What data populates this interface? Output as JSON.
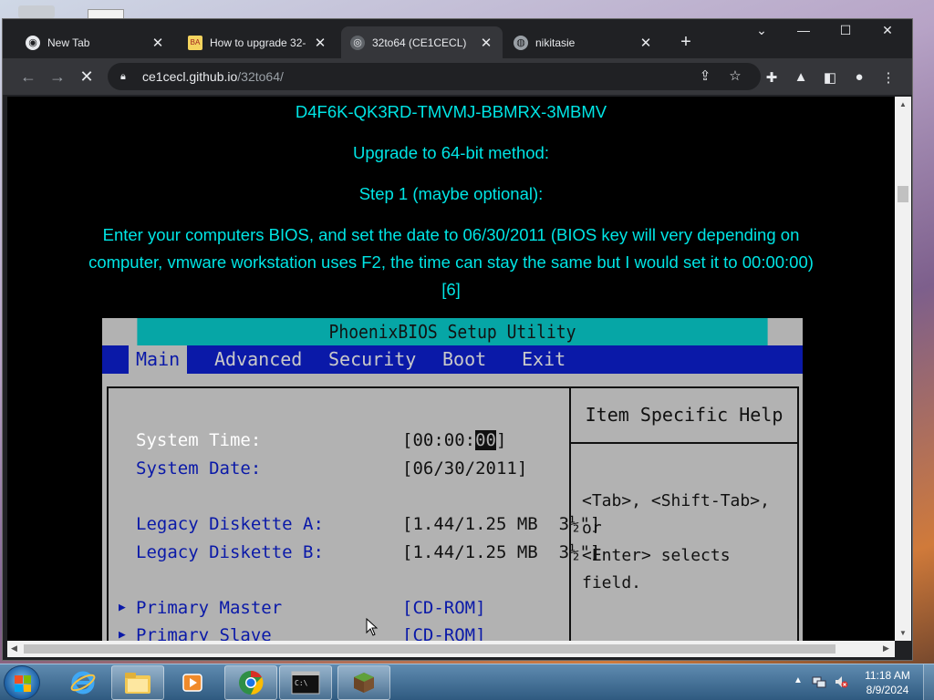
{
  "browser": {
    "tabs": [
      {
        "title": "New Tab",
        "icon": "chrome-icon"
      },
      {
        "title": "How to upgrade 32-",
        "icon": "site-favicon"
      },
      {
        "title": "32to64 (CE1CECL)",
        "icon": "github-favicon",
        "active": true
      },
      {
        "title": "nikitasie",
        "icon": "globe-icon"
      }
    ],
    "new_tab_symbol": "+",
    "window_controls": {
      "tab_search": "⌄",
      "minimize": "—",
      "maximize": "☐",
      "close": "✕"
    },
    "toolbar": {
      "back": "←",
      "forward": "→",
      "stop": "✕",
      "url_host": "ce1cecl.github.io",
      "url_path": "/32to64/"
    }
  },
  "page": {
    "line_key": "D4F6K-QK3RD-TMVMJ-BBMRX-3MBMV",
    "line_method": "Upgrade to 64-bit method:",
    "line_step": "Step 1 (maybe optional):",
    "para_1": "Enter your computers BIOS, and set the date to 06/30/2011 (BIOS key will very depending on",
    "para_2": "computer, vmware workstation uses F2, the time can stay the same but I would set it to 00:00:00)",
    "para_3": "[6]"
  },
  "bios": {
    "title": "PhoenixBIOS Setup Utility",
    "menu": [
      "Main",
      "Advanced",
      "Security",
      "Boot",
      "Exit"
    ],
    "help_title": "Item Specific Help",
    "help_line_1": "<Tab>, <Shift-Tab>, or",
    "help_line_2": "<Enter> selects field.",
    "fields": {
      "system_time_label": "System Time:",
      "system_time_prefix": "[00:00:",
      "system_time_cursor": "00",
      "system_time_suffix": "]",
      "system_date_label": "System Date:",
      "system_date_value": "[06/30/2011]",
      "diskette_a_label": "Legacy Diskette A:",
      "diskette_a_value": "[1.44/1.25 MB  3½\"]",
      "diskette_b_label": "Legacy Diskette B:",
      "diskette_b_value": "[1.44/1.25 MB  3½\"]",
      "primary_master_label": "Primary Master",
      "primary_master_value": "[CD-ROM]",
      "primary_slave_label": "Primary Slave",
      "primary_slave_value": "[CD-ROM]"
    }
  },
  "taskbar": {
    "pinned": [
      "internet-explorer-icon",
      "explorer-folder-icon",
      "media-player-icon",
      "chrome-icon",
      "cmd-icon",
      "minecraft-icon"
    ],
    "tray_expand": "▲",
    "clock_time": "11:18 AM",
    "clock_date": "8/9/2024"
  }
}
